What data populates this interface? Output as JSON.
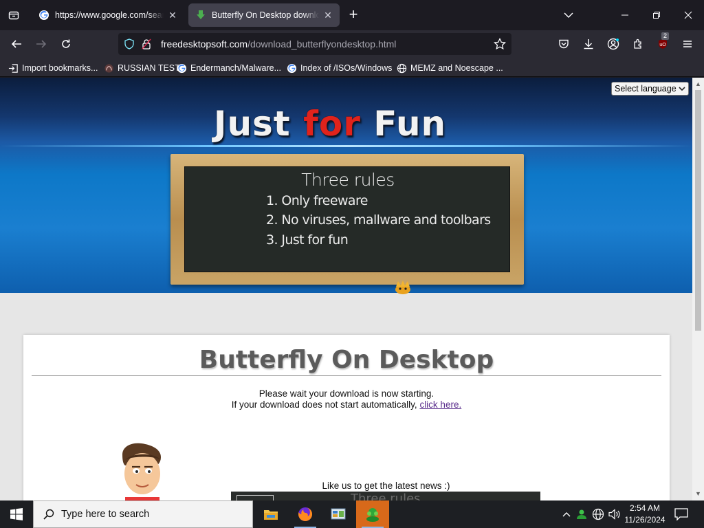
{
  "browser": {
    "tabs": [
      {
        "title": "https://www.google.com/search",
        "active": false
      },
      {
        "title": "Butterfly On Desktop download",
        "active": true
      }
    ],
    "url": {
      "domain": "freedesktopsoft.com",
      "path": "/download_butterflyondesktop.html"
    },
    "extension_badge": "2",
    "bookmarks": [
      {
        "label": "Import bookmarks...",
        "icon": "import-icon"
      },
      {
        "label": "RUSSIAN TEST",
        "icon": "site-icon"
      },
      {
        "label": "Endermanch/Malware...",
        "icon": "google-icon"
      },
      {
        "label": "Index of /ISOs/Windows",
        "icon": "google-icon"
      },
      {
        "label": "MEMZ and Noescape ...",
        "icon": "globe-icon"
      }
    ]
  },
  "page": {
    "language_select": "Select language",
    "hero": {
      "title_pre": "Just ",
      "title_accent": "for",
      "title_post": " Fun"
    },
    "board": {
      "heading": "Three rules",
      "rules": [
        "1. Only freeware",
        "2. No viruses, mallware and toolbars",
        "3. Just for fun"
      ]
    },
    "title": "Butterfly On Desktop",
    "wait_line1": "Please wait your download is now starting.",
    "wait_line2_prefix": "If your download does not start automatically, ",
    "wait_link": "click here.",
    "like_text": "Like us to get the latest news :)",
    "video_thumb_text": "Three rules"
  },
  "taskbar": {
    "search_placeholder": "Type here to search",
    "time": "2:54 AM",
    "date": "11/26/2024"
  },
  "colors": {
    "accent_red": "#e0231c",
    "active_task": "#d8691a",
    "hero_blue": "#1a7fd0"
  }
}
